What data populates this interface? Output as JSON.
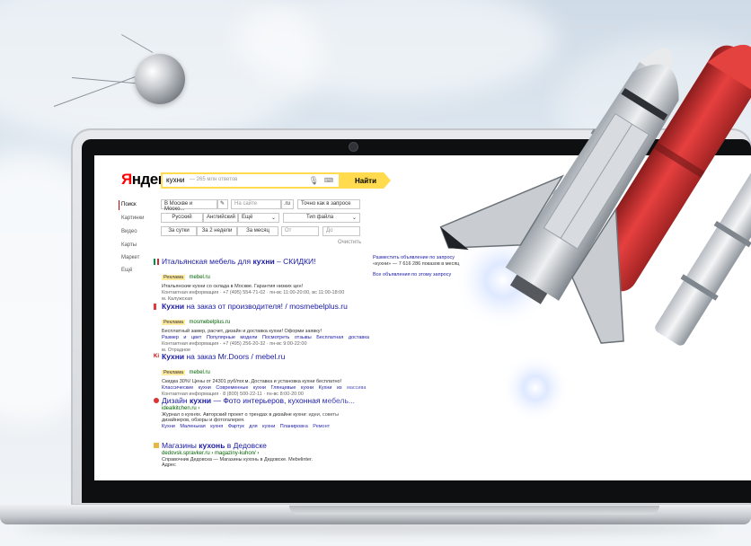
{
  "logo": {
    "first": "Я",
    "rest": "ндекс"
  },
  "search": {
    "query": "кухни",
    "results_count": "— 265 млн ответов",
    "button": "Найти"
  },
  "nav": [
    "Поиск",
    "Картинки",
    "Видео",
    "Карты",
    "Маркет",
    "Ещё"
  ],
  "filters": {
    "region": "В Москве и Моско...",
    "site_placeholder": "На сайте",
    "site_suffix": ".ru",
    "exact": "Точно как в запросе",
    "lang1": "Русский",
    "lang2": "Английский",
    "more": "Ещё",
    "filetype": "Тип файла",
    "day": "За сутки",
    "two_weeks": "За 2 недели",
    "month": "За месяц",
    "from": "От",
    "to": "До",
    "clear": "Очистить"
  },
  "results": [
    {
      "title_pre": "Итальянская мебель для ",
      "title_bold": "кухни",
      "title_post": " – СКИДКИ!",
      "badge": "Реклама",
      "url": "mebel.ru",
      "snippet": "Итальянские кухни со склада в Москве. Гарантия низких цен!",
      "contact": "Контактная информация · +7 (495) 554-71-02 · пн-вс 11:00-20:00, вс 11:00-18:00",
      "extra": "м. Калужская"
    },
    {
      "title_pre": "",
      "title_bold": "Кухни",
      "title_post": " на заказ от производителя! / mosmebelplus.ru",
      "badge": "Реклама",
      "url": "mosmebelplus.ru",
      "snippet": "Бесплатный замер, расчет, дизайн и доставка кухни! Оформи заявку!",
      "links": "Размер и цвет  Популярные модели  Посмотреть отзывы  Бесплатная доставка",
      "contact": "Контактная информация · +7 (495) 256-20-32 · пн-вс 9:00-22:00",
      "extra": "м. Отрадное"
    },
    {
      "title_pre": "",
      "title_bold": "Кухни",
      "title_post": " на заказ Mr.Doors / mebel.ru",
      "badge": "Реклама",
      "url": "mebel.ru",
      "snippet": "Скидка 30%! Цены от 24301 руб/пог.м. Доставка и установка кухни бесплатно!",
      "links": "Классические кухни  Современные кухни  Глянцевые кухни  Кухни из массива",
      "contact": "Контактная информация · 8 (800) 500-22-11 · пн-вс 8:00-20:00"
    },
    {
      "title_pre": "Дизайн ",
      "title_bold": "кухни",
      "title_post": " — Фото интерьеров, кухонная мебель...",
      "url": "idealkitchen.ru ›",
      "snippet": "Журнал о кухнях. Авторский проект о трендах в дизайне кухни: идеи, советы",
      "snippet2": "дизайнеров, обзоры и фотогалерея.",
      "links": "Кухни  Маленькая кухня  Фартук для кухни  Планировка  Ремонт"
    },
    {
      "title_pre": "Магазины ",
      "title_bold": "кухонь",
      "title_post": " в Дедовске",
      "url": "dedovsk.spravker.ru › magaziny-kuhon/ ›",
      "snippet": "Справочник Дедовска — Магазины кухонь в Дедовске. Mebelinter.",
      "snippet2": "Адрес"
    }
  ],
  "right": {
    "line1": "Разместить объявление по запросу",
    "line2": "«кухни» — 7 616 286 показов в месяц",
    "line3": "Все объявления по этому запросу"
  },
  "colors": {
    "accent": "#ffdb4d",
    "link": "#1a1aa6",
    "url": "#006000",
    "logo_red": "#ff0000"
  }
}
